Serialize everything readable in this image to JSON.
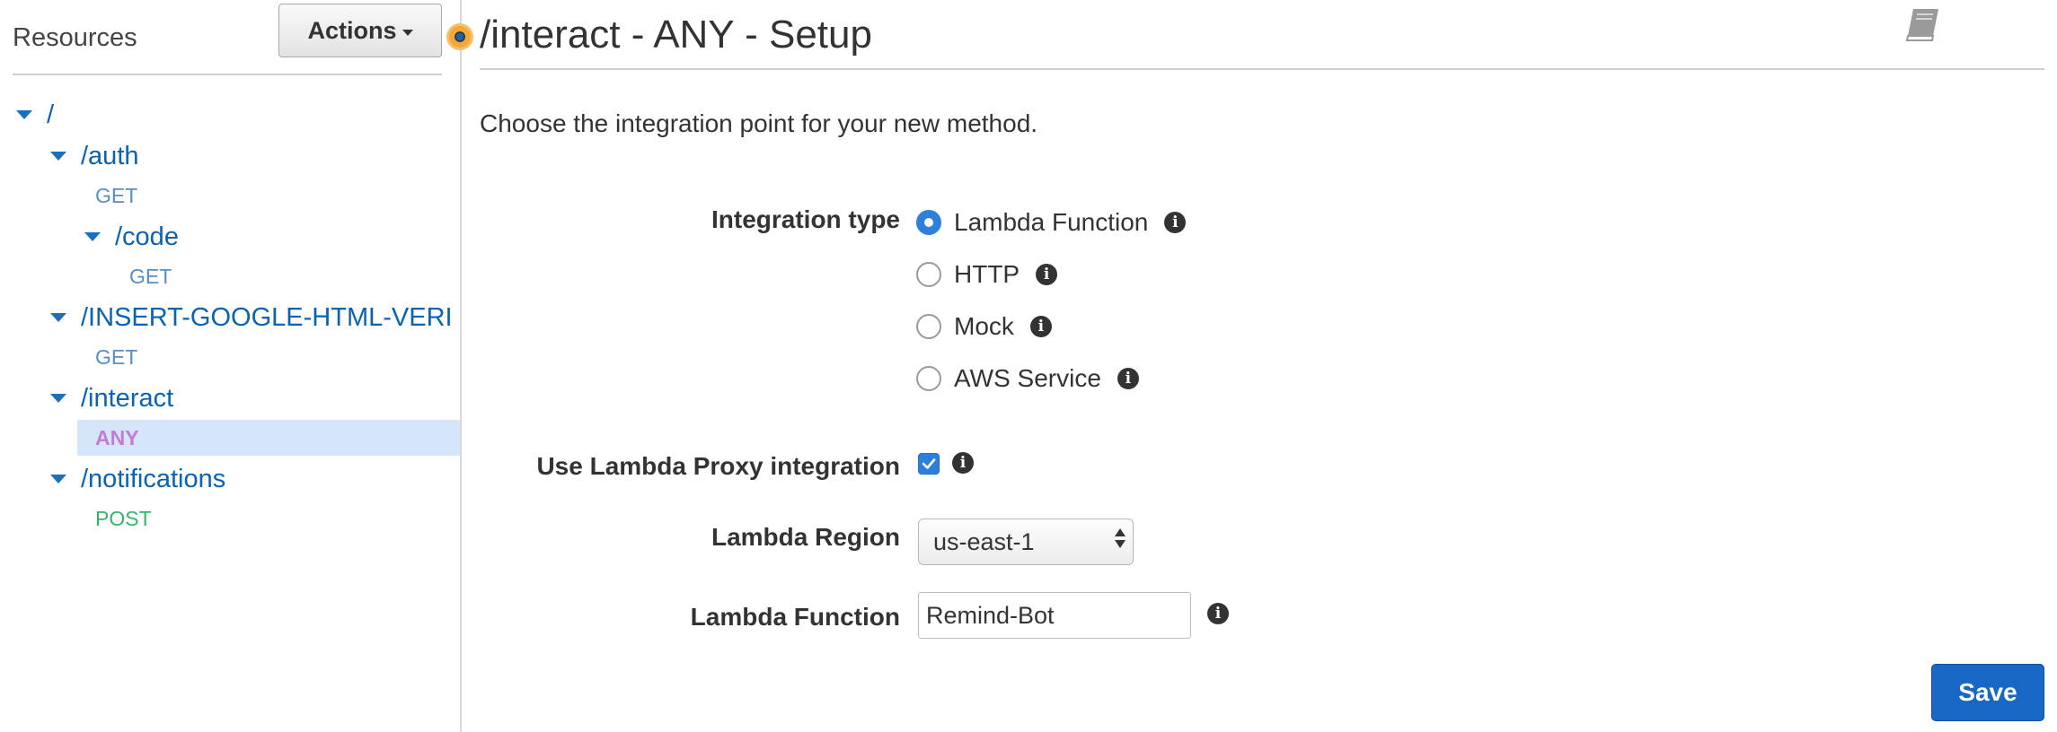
{
  "sidebar": {
    "title": "Resources",
    "actions_label": "Actions",
    "tree": [
      {
        "kind": "resource",
        "label": "/"
      },
      {
        "kind": "resource",
        "label": "/auth"
      },
      {
        "kind": "method",
        "label": "GET"
      },
      {
        "kind": "resource",
        "label": "/code"
      },
      {
        "kind": "method",
        "label": "GET"
      },
      {
        "kind": "resource",
        "label": "/INSERT-GOOGLE-HTML-VERI"
      },
      {
        "kind": "method",
        "label": "GET"
      },
      {
        "kind": "resource",
        "label": "/interact"
      },
      {
        "kind": "method",
        "label": "ANY",
        "selected": true
      },
      {
        "kind": "resource",
        "label": "/notifications"
      },
      {
        "kind": "method",
        "label": "POST"
      }
    ]
  },
  "main": {
    "title": "/interact - ANY - Setup",
    "docs_icon": "book-icon",
    "intro": "Choose the integration point for your new method.",
    "integration_type": {
      "label": "Integration type",
      "options": [
        {
          "label": "Lambda Function",
          "checked": true
        },
        {
          "label": "HTTP",
          "checked": false
        },
        {
          "label": "Mock",
          "checked": false
        },
        {
          "label": "AWS Service",
          "checked": false
        }
      ]
    },
    "proxy": {
      "label": "Use Lambda Proxy integration",
      "checked": true
    },
    "region": {
      "label": "Lambda Region",
      "value": "us-east-1"
    },
    "function": {
      "label": "Lambda Function",
      "value": "Remind-Bot"
    },
    "info_icon": "i",
    "save_label": "Save"
  },
  "colors": {
    "link": "#0a62b0",
    "accent": "#2e7fdc",
    "save": "#1767c4",
    "method_get": "#5b8ec2",
    "method_any": "#c57bd6",
    "method_post": "#39b36b",
    "selected_row": "#d5e6fb",
    "splitter_knob": "#f7a734"
  }
}
